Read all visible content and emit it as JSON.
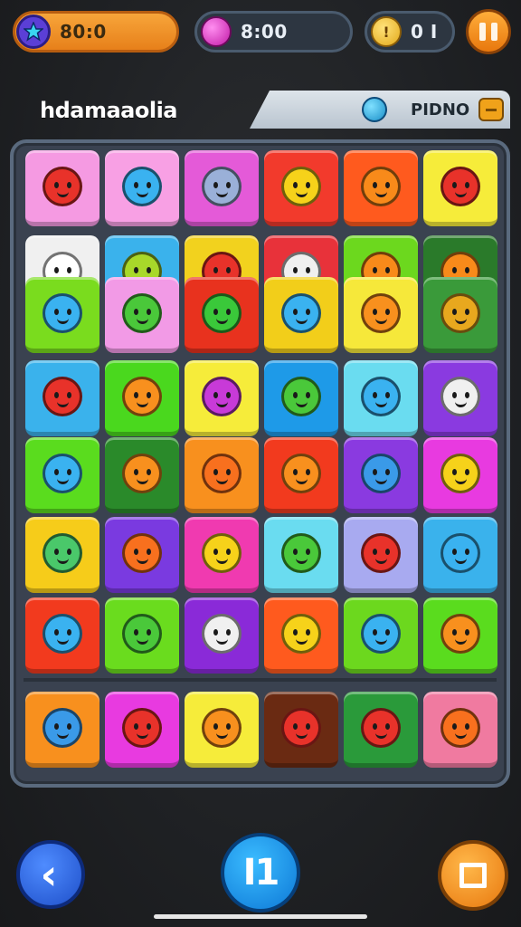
{
  "hud": {
    "score": "80:0",
    "timer": "8:00",
    "coins": "0 I",
    "coin_symbol": "!"
  },
  "level": {
    "title": "hdamaaolia",
    "mode_label": "PIDNO"
  },
  "bottom_nav": {
    "back_symbol": "‹",
    "center_label": "I1"
  },
  "board": {
    "rows": [
      [
        "#f59ae2",
        "#f8a0e4",
        "#e45ad8",
        "#f23a2c",
        "#ff5a1e",
        "#f6ec3a"
      ],
      [
        "#f0f0f0",
        "#3ab2ec",
        "#f2d21e",
        "#e8323a",
        "#6cd81e",
        "#2a7a2a"
      ],
      [
        "#7adc1e",
        "#f29ae6",
        "#e8321e",
        "#f2ce1a",
        "#f6e83a",
        "#3a9a3a"
      ],
      [
        "#3ab2ec",
        "#4ad81e",
        "#f6ec3a",
        "#1e9ae8",
        "#6adcf0",
        "#8a3ae0"
      ],
      [
        "#5adc1e",
        "#2a8a2a",
        "#f8901e",
        "#f23a1e",
        "#8a3ae0",
        "#e83ae0"
      ],
      [
        "#f6cc1a",
        "#7a3ae0",
        "#f03ab0",
        "#6adcf0",
        "#a8aaf0",
        "#3ab2ec"
      ],
      [
        "#f23a1e",
        "#6adc1e",
        "#8a2ad8",
        "#ff5a1e",
        "#6cd81e",
        "#5adc1e"
      ]
    ],
    "extra_row": [
      "#f8901e",
      "#e83ae0",
      "#f6ec3a",
      "#6a2a12",
      "#2a9a3a",
      "#f07aa0"
    ],
    "pieces": [
      [
        "#e8322a",
        "#3ab2f0",
        "#9ab0d8",
        "#f6d21a",
        "#f88a1a",
        "#e8322a"
      ],
      [
        "#ffffff",
        "#a8d82a",
        "#e8322a",
        "#f0f0f0",
        "#f88a1a",
        "#f88a1a"
      ],
      [
        "#3ab2f0",
        "#4ac83a",
        "#3ac83a",
        "#3ab2f0",
        "#f8901e",
        "#e8a81e"
      ],
      [
        "#e8322a",
        "#f8901e",
        "#c83ad8",
        "#4ac83a",
        "#3ab2f0",
        "#f0f0f0"
      ],
      [
        "#3ab2f0",
        "#f8901e",
        "#f8701e",
        "#f8901e",
        "#3a9ae8",
        "#f6d21a"
      ],
      [
        "#4ac86a",
        "#f8701e",
        "#f6d21a",
        "#4ac83a",
        "#e8322a",
        "#3ab2f0"
      ],
      [
        "#3ab2f0",
        "#4ac83a",
        "#f0f0f0",
        "#f6d21a",
        "#3ab2f0",
        "#f8901e"
      ]
    ],
    "extra_pieces": [
      "#3a9ae8",
      "#e8322a",
      "#f8901e",
      "#e8322a",
      "#e8322a",
      "#f8701e"
    ]
  }
}
